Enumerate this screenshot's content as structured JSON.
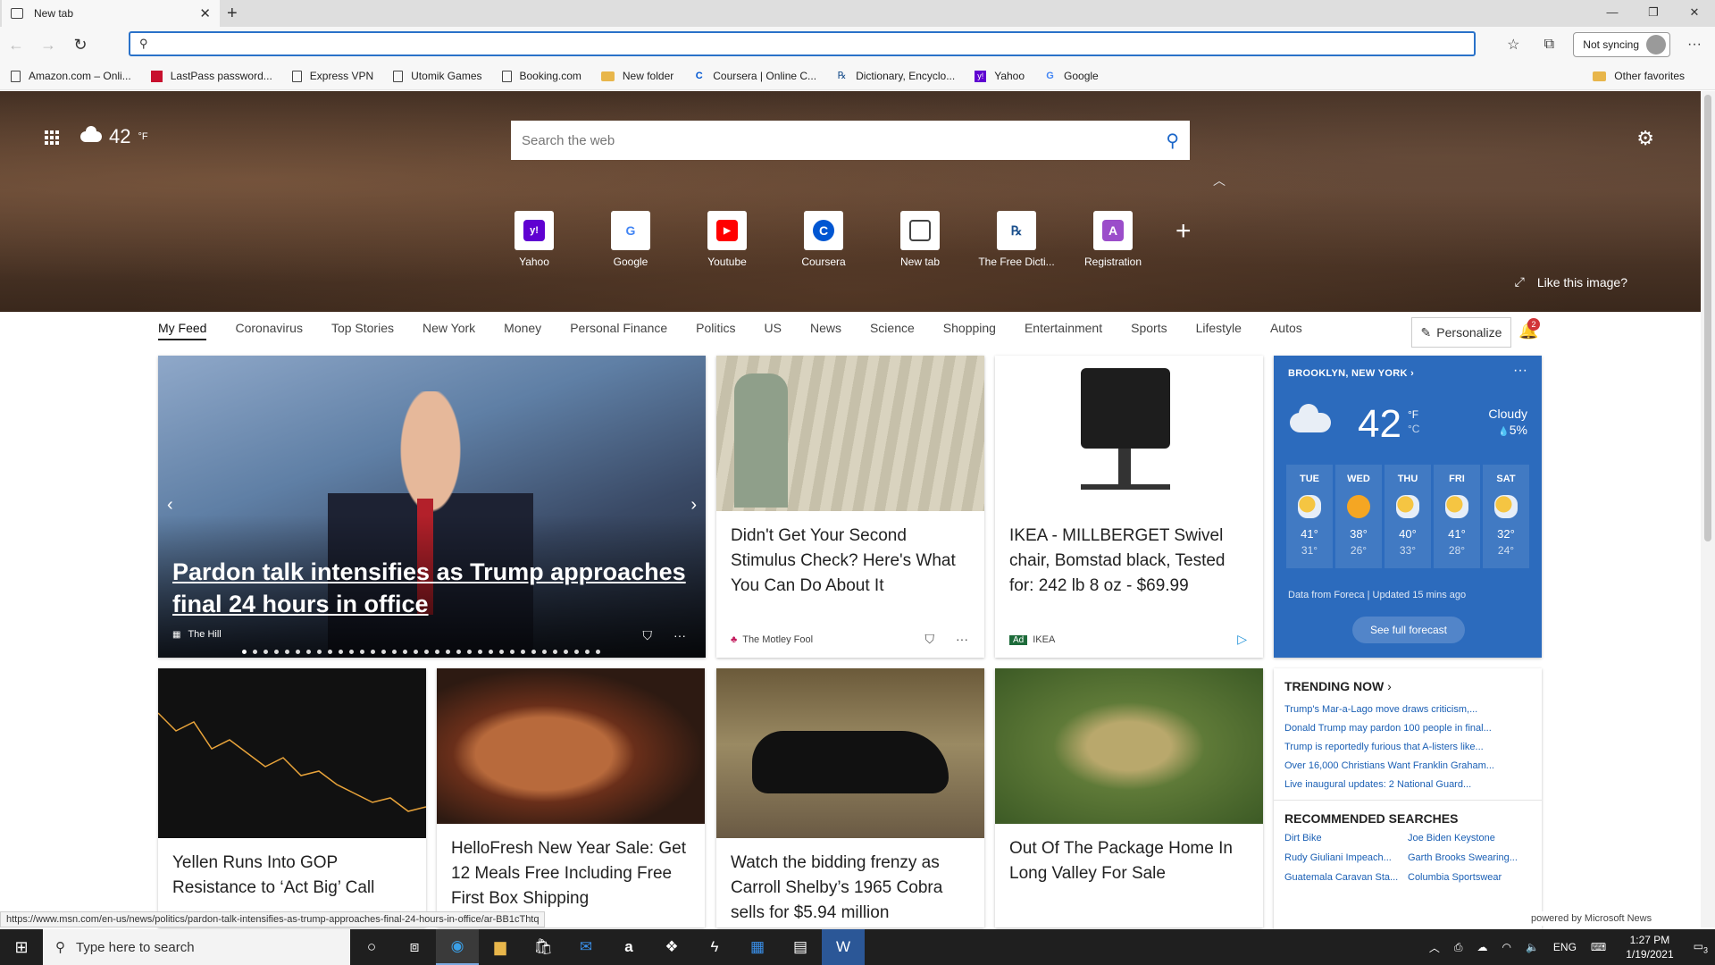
{
  "browser": {
    "tab_title": "New tab",
    "address_placeholder": "",
    "sync_label": "Not syncing"
  },
  "favorites": [
    {
      "label": "Amazon.com – Onli...",
      "icon": "page-icon"
    },
    {
      "label": "LastPass password...",
      "icon": "lastpass-icon"
    },
    {
      "label": "Express VPN",
      "icon": "page-icon"
    },
    {
      "label": "Utomik Games",
      "icon": "page-icon"
    },
    {
      "label": "Booking.com",
      "icon": "page-icon"
    },
    {
      "label": "New folder",
      "icon": "folder-icon"
    },
    {
      "label": "Coursera | Online C...",
      "icon": "coursera-icon"
    },
    {
      "label": "Dictionary, Encyclo...",
      "icon": "dictionary-icon"
    },
    {
      "label": "Yahoo",
      "icon": "yahoo-icon"
    },
    {
      "label": "Google",
      "icon": "google-icon"
    }
  ],
  "other_favorites": "Other favorites",
  "hero": {
    "temperature": "42",
    "temp_unit": "°F",
    "search_placeholder": "Search the web",
    "like_image": "Like this image?",
    "tiles": [
      {
        "label": "Yahoo",
        "glyph": "y!",
        "color": "#5f01d1"
      },
      {
        "label": "Google",
        "glyph": "G",
        "color": "#4285f4"
      },
      {
        "label": "Youtube",
        "glyph": "▶",
        "color": "#ff0000"
      },
      {
        "label": "Coursera",
        "glyph": "C",
        "color": "#0056d2"
      },
      {
        "label": "New tab",
        "glyph": "▤",
        "color": "#444444"
      },
      {
        "label": "The Free Dicti...",
        "glyph": "℞",
        "color": "#1a4f8c"
      },
      {
        "label": "Registration",
        "glyph": "A",
        "color": "#9b4dca"
      }
    ]
  },
  "feed_tabs": [
    "My Feed",
    "Coronavirus",
    "Top Stories",
    "New York",
    "Money",
    "Personal Finance",
    "Politics",
    "US",
    "News",
    "Science",
    "Shopping",
    "Entertainment",
    "Sports",
    "Lifestyle",
    "Autos"
  ],
  "personalize_label": "Personalize",
  "notification_count": "2",
  "top_story": {
    "title": "Pardon talk intensifies as Trump approaches final 24 hours in office",
    "source": "The Hill"
  },
  "cards": {
    "stimulus": {
      "title": "Didn't Get Your Second Stimulus Check? Here's What You Can Do About It",
      "source": "The Motley Fool"
    },
    "ikea": {
      "title": "IKEA - MILLBERGET Swivel chair, Bomstad black, Tested for: 242 lb 8 oz - $69.99",
      "ad": "Ad",
      "source": "IKEA"
    },
    "yellen": {
      "title": "Yellen Runs Into GOP Resistance to ‘Act Big’ Call"
    },
    "hellofresh": {
      "title": "HelloFresh New Year Sale: Get 12 Meals Free Including Free First Box Shipping"
    },
    "cobra": {
      "title": "Watch the bidding frenzy as Carroll Shelby’s 1965 Cobra sells for $5.94 million"
    },
    "home": {
      "title": "Out Of The Package Home In Long Valley For Sale"
    }
  },
  "weather": {
    "location": "BROOKLYN, NEW YORK",
    "temp": "42",
    "unit_f": "°F",
    "unit_c": "°C",
    "condition": "Cloudy",
    "precip": "5%",
    "days": [
      {
        "day": "TUE",
        "hi": "41°",
        "lo": "31°",
        "icon": "partly-cloudy"
      },
      {
        "day": "WED",
        "hi": "38°",
        "lo": "26°",
        "icon": "sunny"
      },
      {
        "day": "THU",
        "hi": "40°",
        "lo": "33°",
        "icon": "partly-cloudy"
      },
      {
        "day": "FRI",
        "hi": "41°",
        "lo": "28°",
        "icon": "partly-cloudy"
      },
      {
        "day": "SAT",
        "hi": "32°",
        "lo": "24°",
        "icon": "partly-cloudy"
      }
    ],
    "footer": "Data from Foreca | Updated 15 mins ago",
    "forecast_button": "See full forecast"
  },
  "trending": {
    "title": "TRENDING NOW",
    "items": [
      "Trump's Mar-a-Lago move draws criticism,...",
      "Donald Trump may pardon 100 people in final...",
      "Trump is reportedly furious that A-listers like...",
      "Over 16,000 Christians Want Franklin Graham...",
      "Live inaugural updates: 2 National Guard..."
    ],
    "rec_title": "RECOMMENDED SEARCHES",
    "rec": [
      "Dirt Bike",
      "Joe Biden Keystone",
      "Rudy Giuliani Impeach...",
      "Garth Brooks Swearing...",
      "Guatemala Caravan Sta...",
      "Columbia Sportswear"
    ]
  },
  "powered_by": "powered by Microsoft News",
  "status_url": "https://www.msn.com/en-us/news/politics/pardon-talk-intensifies-as-trump-approaches-final-24-hours-in-office/ar-BB1cThtq",
  "taskbar": {
    "search_placeholder": "Type here to search",
    "lang": "ENG",
    "time": "1:27 PM",
    "date": "1/19/2021",
    "notif_count": "3"
  }
}
